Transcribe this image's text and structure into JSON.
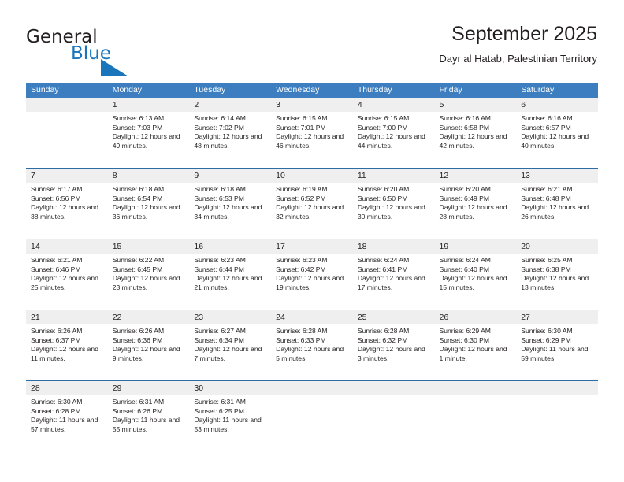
{
  "brand": {
    "name_part1": "General",
    "name_part2": "Blue",
    "accent_color": "#1b75bb"
  },
  "header": {
    "title": "September 2025",
    "subtitle": "Dayr al Hatab, Palestinian Territory"
  },
  "calendar": {
    "header_color": "#3c7ebf",
    "row_separator_color": "#2e6ca4",
    "date_strip_color": "#efefef",
    "weekday_headers": [
      "Sunday",
      "Monday",
      "Tuesday",
      "Wednesday",
      "Thursday",
      "Friday",
      "Saturday"
    ],
    "weeks": [
      [
        {
          "day": "",
          "sunrise": "",
          "sunset": "",
          "daylight": "",
          "empty": true
        },
        {
          "day": "1",
          "sunrise": "Sunrise: 6:13 AM",
          "sunset": "Sunset: 7:03 PM",
          "daylight": "Daylight: 12 hours and 49 minutes."
        },
        {
          "day": "2",
          "sunrise": "Sunrise: 6:14 AM",
          "sunset": "Sunset: 7:02 PM",
          "daylight": "Daylight: 12 hours and 48 minutes."
        },
        {
          "day": "3",
          "sunrise": "Sunrise: 6:15 AM",
          "sunset": "Sunset: 7:01 PM",
          "daylight": "Daylight: 12 hours and 46 minutes."
        },
        {
          "day": "4",
          "sunrise": "Sunrise: 6:15 AM",
          "sunset": "Sunset: 7:00 PM",
          "daylight": "Daylight: 12 hours and 44 minutes."
        },
        {
          "day": "5",
          "sunrise": "Sunrise: 6:16 AM",
          "sunset": "Sunset: 6:58 PM",
          "daylight": "Daylight: 12 hours and 42 minutes."
        },
        {
          "day": "6",
          "sunrise": "Sunrise: 6:16 AM",
          "sunset": "Sunset: 6:57 PM",
          "daylight": "Daylight: 12 hours and 40 minutes."
        }
      ],
      [
        {
          "day": "7",
          "sunrise": "Sunrise: 6:17 AM",
          "sunset": "Sunset: 6:56 PM",
          "daylight": "Daylight: 12 hours and 38 minutes."
        },
        {
          "day": "8",
          "sunrise": "Sunrise: 6:18 AM",
          "sunset": "Sunset: 6:54 PM",
          "daylight": "Daylight: 12 hours and 36 minutes."
        },
        {
          "day": "9",
          "sunrise": "Sunrise: 6:18 AM",
          "sunset": "Sunset: 6:53 PM",
          "daylight": "Daylight: 12 hours and 34 minutes."
        },
        {
          "day": "10",
          "sunrise": "Sunrise: 6:19 AM",
          "sunset": "Sunset: 6:52 PM",
          "daylight": "Daylight: 12 hours and 32 minutes."
        },
        {
          "day": "11",
          "sunrise": "Sunrise: 6:20 AM",
          "sunset": "Sunset: 6:50 PM",
          "daylight": "Daylight: 12 hours and 30 minutes."
        },
        {
          "day": "12",
          "sunrise": "Sunrise: 6:20 AM",
          "sunset": "Sunset: 6:49 PM",
          "daylight": "Daylight: 12 hours and 28 minutes."
        },
        {
          "day": "13",
          "sunrise": "Sunrise: 6:21 AM",
          "sunset": "Sunset: 6:48 PM",
          "daylight": "Daylight: 12 hours and 26 minutes."
        }
      ],
      [
        {
          "day": "14",
          "sunrise": "Sunrise: 6:21 AM",
          "sunset": "Sunset: 6:46 PM",
          "daylight": "Daylight: 12 hours and 25 minutes."
        },
        {
          "day": "15",
          "sunrise": "Sunrise: 6:22 AM",
          "sunset": "Sunset: 6:45 PM",
          "daylight": "Daylight: 12 hours and 23 minutes."
        },
        {
          "day": "16",
          "sunrise": "Sunrise: 6:23 AM",
          "sunset": "Sunset: 6:44 PM",
          "daylight": "Daylight: 12 hours and 21 minutes."
        },
        {
          "day": "17",
          "sunrise": "Sunrise: 6:23 AM",
          "sunset": "Sunset: 6:42 PM",
          "daylight": "Daylight: 12 hours and 19 minutes."
        },
        {
          "day": "18",
          "sunrise": "Sunrise: 6:24 AM",
          "sunset": "Sunset: 6:41 PM",
          "daylight": "Daylight: 12 hours and 17 minutes."
        },
        {
          "day": "19",
          "sunrise": "Sunrise: 6:24 AM",
          "sunset": "Sunset: 6:40 PM",
          "daylight": "Daylight: 12 hours and 15 minutes."
        },
        {
          "day": "20",
          "sunrise": "Sunrise: 6:25 AM",
          "sunset": "Sunset: 6:38 PM",
          "daylight": "Daylight: 12 hours and 13 minutes."
        }
      ],
      [
        {
          "day": "21",
          "sunrise": "Sunrise: 6:26 AM",
          "sunset": "Sunset: 6:37 PM",
          "daylight": "Daylight: 12 hours and 11 minutes."
        },
        {
          "day": "22",
          "sunrise": "Sunrise: 6:26 AM",
          "sunset": "Sunset: 6:36 PM",
          "daylight": "Daylight: 12 hours and 9 minutes."
        },
        {
          "day": "23",
          "sunrise": "Sunrise: 6:27 AM",
          "sunset": "Sunset: 6:34 PM",
          "daylight": "Daylight: 12 hours and 7 minutes."
        },
        {
          "day": "24",
          "sunrise": "Sunrise: 6:28 AM",
          "sunset": "Sunset: 6:33 PM",
          "daylight": "Daylight: 12 hours and 5 minutes."
        },
        {
          "day": "25",
          "sunrise": "Sunrise: 6:28 AM",
          "sunset": "Sunset: 6:32 PM",
          "daylight": "Daylight: 12 hours and 3 minutes."
        },
        {
          "day": "26",
          "sunrise": "Sunrise: 6:29 AM",
          "sunset": "Sunset: 6:30 PM",
          "daylight": "Daylight: 12 hours and 1 minute."
        },
        {
          "day": "27",
          "sunrise": "Sunrise: 6:30 AM",
          "sunset": "Sunset: 6:29 PM",
          "daylight": "Daylight: 11 hours and 59 minutes."
        }
      ],
      [
        {
          "day": "28",
          "sunrise": "Sunrise: 6:30 AM",
          "sunset": "Sunset: 6:28 PM",
          "daylight": "Daylight: 11 hours and 57 minutes."
        },
        {
          "day": "29",
          "sunrise": "Sunrise: 6:31 AM",
          "sunset": "Sunset: 6:26 PM",
          "daylight": "Daylight: 11 hours and 55 minutes."
        },
        {
          "day": "30",
          "sunrise": "Sunrise: 6:31 AM",
          "sunset": "Sunset: 6:25 PM",
          "daylight": "Daylight: 11 hours and 53 minutes."
        },
        {
          "day": "",
          "sunrise": "",
          "sunset": "",
          "daylight": "",
          "empty": true
        },
        {
          "day": "",
          "sunrise": "",
          "sunset": "",
          "daylight": "",
          "empty": true
        },
        {
          "day": "",
          "sunrise": "",
          "sunset": "",
          "daylight": "",
          "empty": true
        },
        {
          "day": "",
          "sunrise": "",
          "sunset": "",
          "daylight": "",
          "empty": true
        }
      ]
    ]
  }
}
